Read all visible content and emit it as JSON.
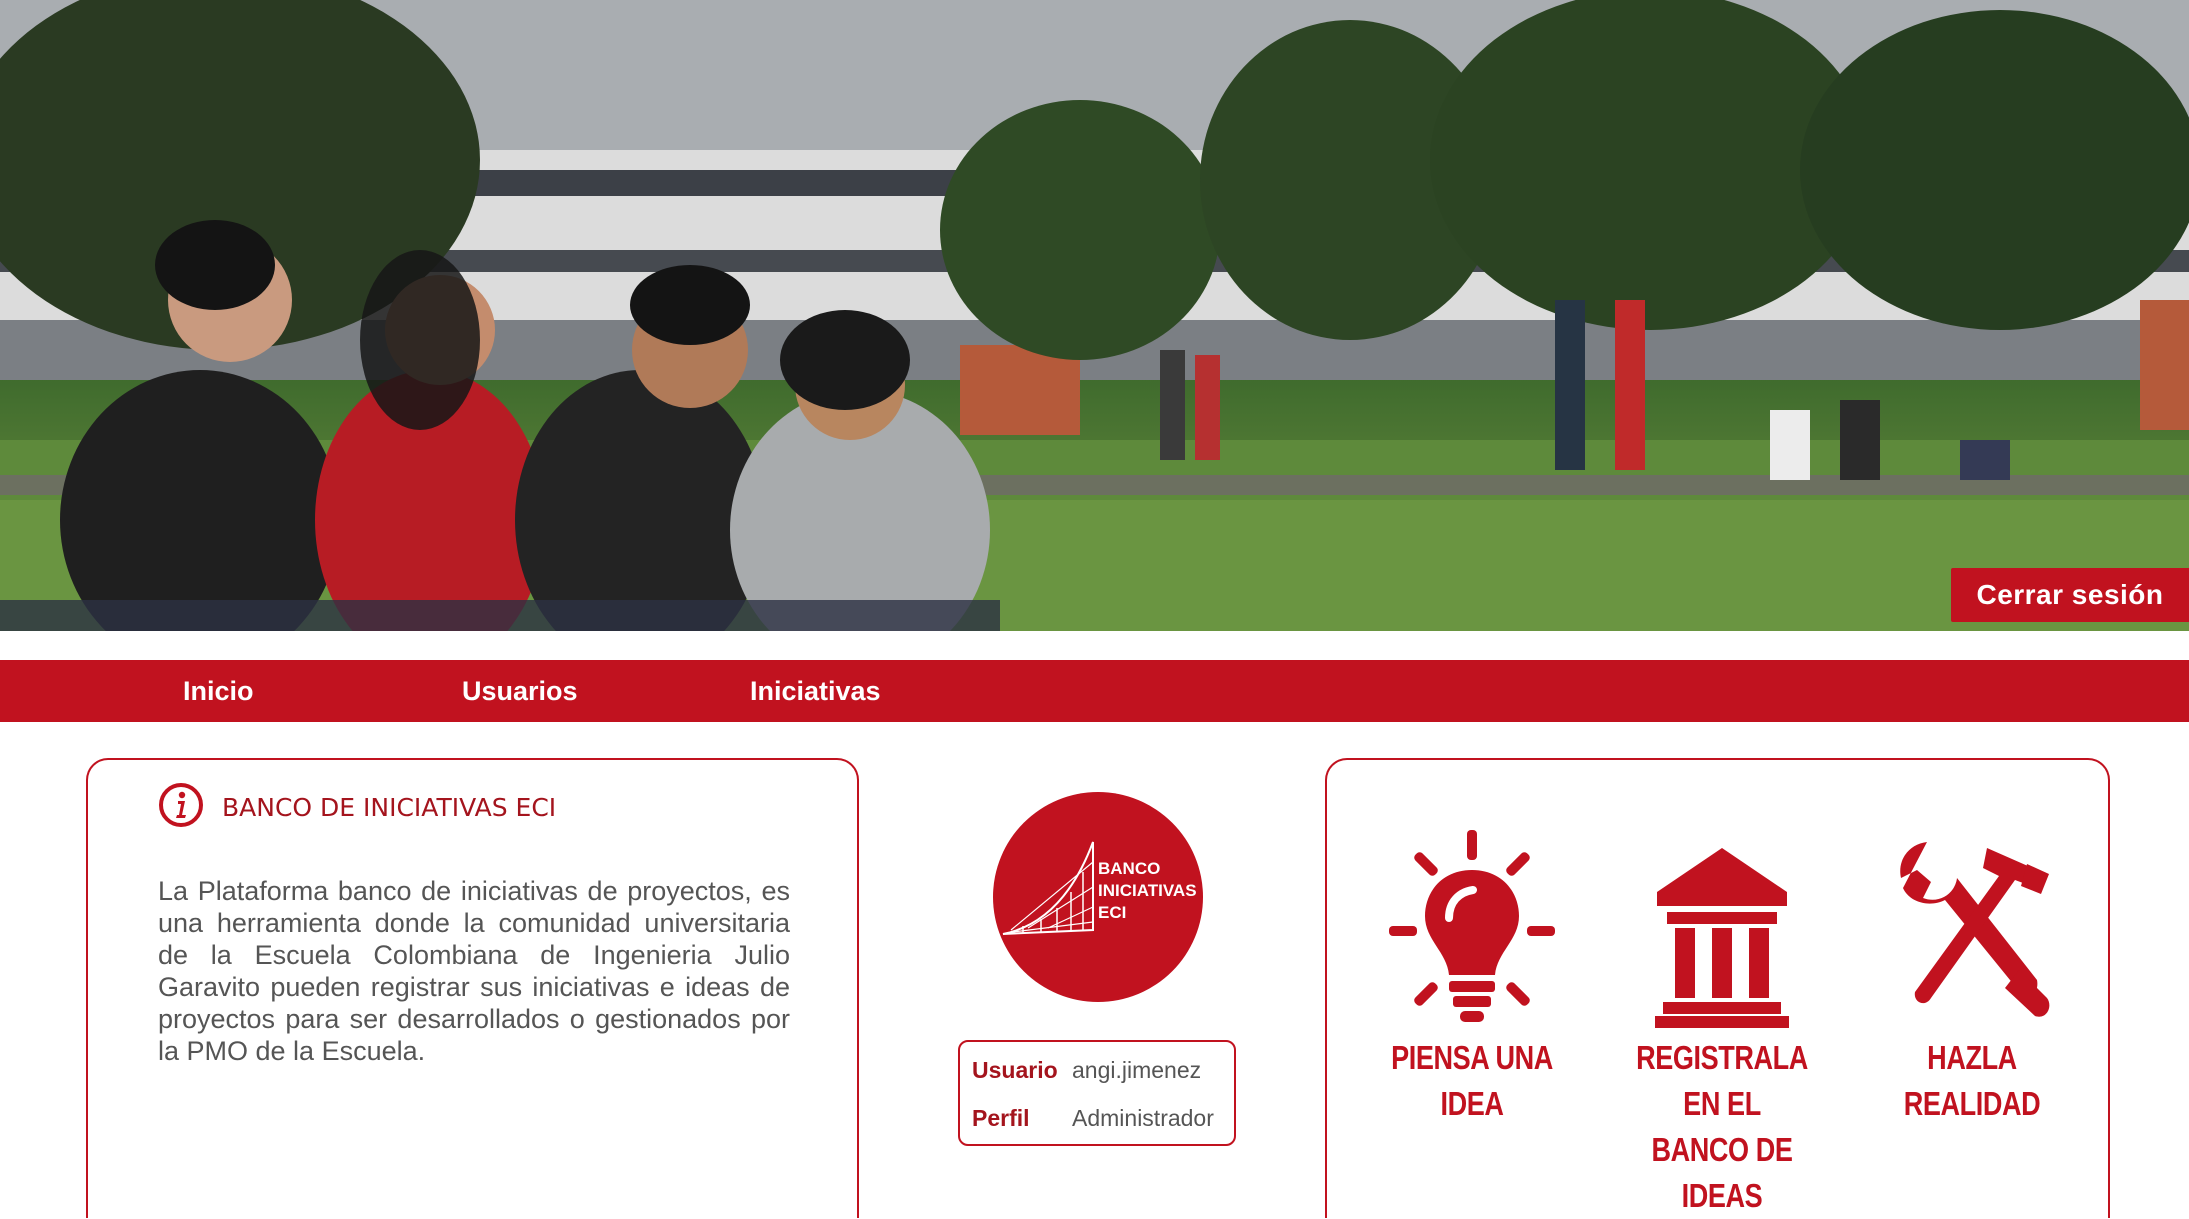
{
  "header": {
    "logout_label": "Cerrar sesión"
  },
  "nav": {
    "items": [
      {
        "label": "Inicio"
      },
      {
        "label": "Usuarios"
      },
      {
        "label": "Iniciativas"
      }
    ]
  },
  "info": {
    "icon": "info-icon",
    "title": "BANCO DE INICIATIVAS ECI",
    "description": "La Plataforma banco de iniciativas de proyectos, es una herramienta donde la comunidad universitaria de la Escuela Colombiana de Ingenieria Julio Garavito pueden registrar sus iniciativas e ideas de proyectos para ser desarrollados o gestionados por la PMO de la Escuela."
  },
  "logo": {
    "lines": [
      "BANCO",
      "INICIATIVAS",
      "ECI"
    ]
  },
  "user": {
    "user_label": "Usuario",
    "user_value": "angi.jimenez",
    "profile_label": "Perfil",
    "profile_value": "Administrador"
  },
  "steps": [
    {
      "icon": "lightbulb-icon",
      "line1": "PIENSA UNA",
      "line2": "IDEA"
    },
    {
      "icon": "bank-icon",
      "line1": "REGISTRALA EN EL",
      "line2": "BANCO DE IDEAS"
    },
    {
      "icon": "tools-icon",
      "line1": "HAZLA",
      "line2": "REALIDAD"
    }
  ],
  "colors": {
    "brand_red": "#c1121f",
    "text_gray": "#555555"
  }
}
